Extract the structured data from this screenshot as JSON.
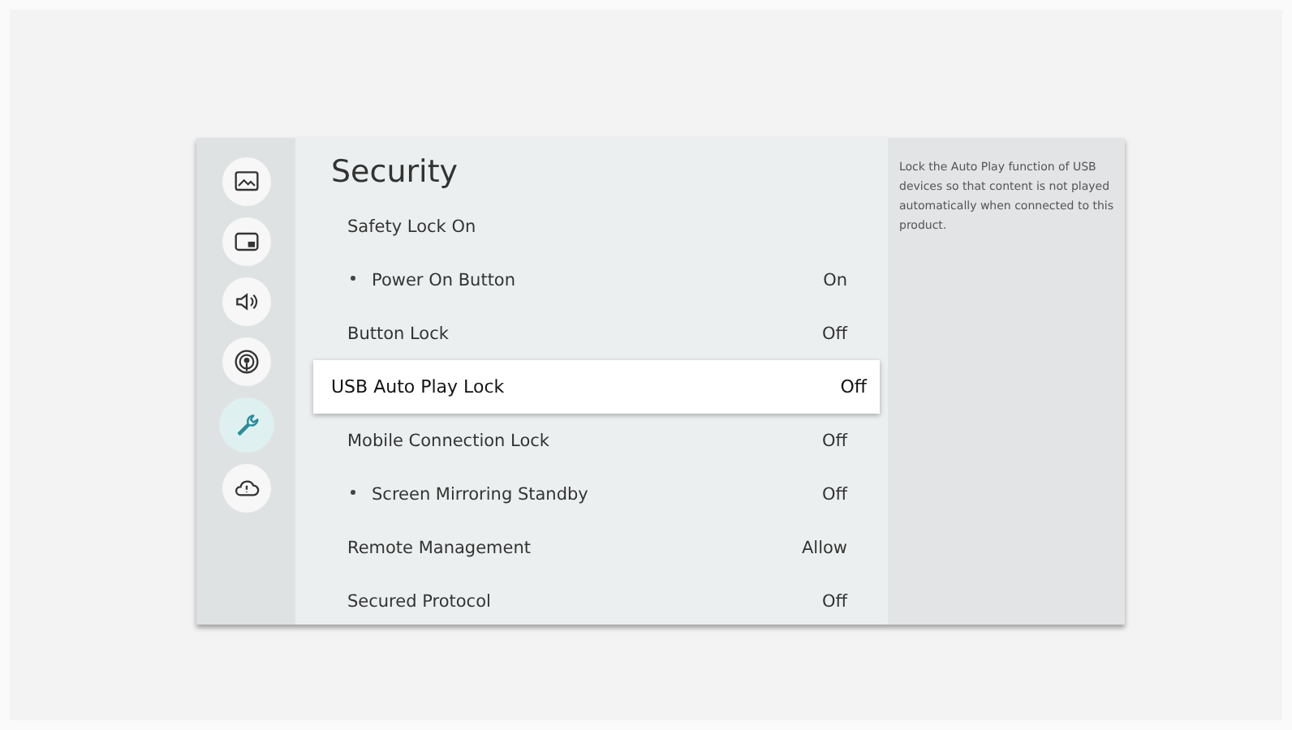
{
  "sidebar": {
    "items": [
      {
        "selected": false
      },
      {
        "selected": false
      },
      {
        "selected": false
      },
      {
        "selected": false
      },
      {
        "selected": true
      },
      {
        "selected": false
      }
    ]
  },
  "title": "Security",
  "settings": [
    {
      "kind": "header",
      "label": "Safety Lock On",
      "selected": false
    },
    {
      "kind": "sub",
      "label": "Power On Button",
      "value": "On",
      "selected": false
    },
    {
      "kind": "item",
      "label": "Button Lock",
      "value": "Off",
      "selected": false
    },
    {
      "kind": "item",
      "label": "USB Auto Play Lock",
      "value": "Off",
      "selected": true
    },
    {
      "kind": "item",
      "label": "Mobile Connection Lock",
      "value": "Off",
      "selected": false
    },
    {
      "kind": "sub",
      "label": "Screen Mirroring Standby",
      "value": "Off",
      "selected": false
    },
    {
      "kind": "item",
      "label": "Remote Management",
      "value": "Allow",
      "selected": false
    },
    {
      "kind": "item",
      "label": "Secured Protocol",
      "value": "Off",
      "selected": false
    }
  ],
  "help_text": "Lock the Auto Play function of USB devices so that content is not played automatically when connected to this product."
}
